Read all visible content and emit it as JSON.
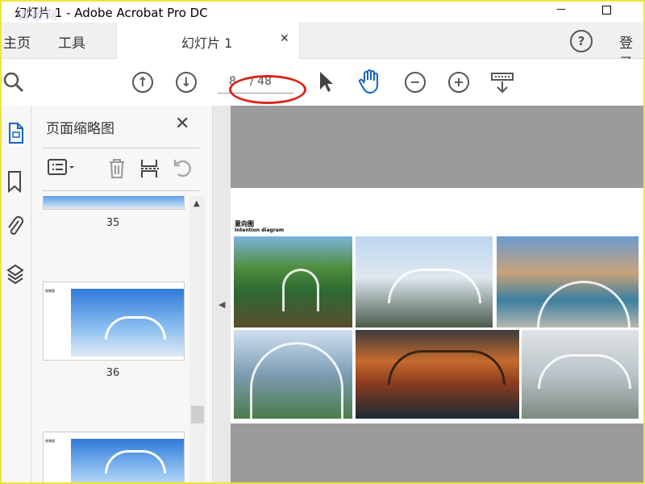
{
  "window": {
    "title": "幻灯片 1 - Adobe Acrobat Pro DC",
    "watermark": "道桥网"
  },
  "tabs": {
    "home": "主页",
    "tools": "工具",
    "document": "幻灯片 1",
    "login": "登录"
  },
  "toolbar": {
    "current_page": "8",
    "total_pages": "/ 48"
  },
  "panel": {
    "title": "页面缩略图",
    "thumbnails": [
      {
        "number": "35"
      },
      {
        "number": "36",
        "caption": "效果图"
      },
      {
        "caption": "效果图"
      }
    ]
  },
  "page": {
    "heading_cn": "意向图",
    "heading_en": "Intention diagram"
  },
  "colors": {
    "annotation": "#d9261c",
    "window_border": "#f0e63a"
  }
}
